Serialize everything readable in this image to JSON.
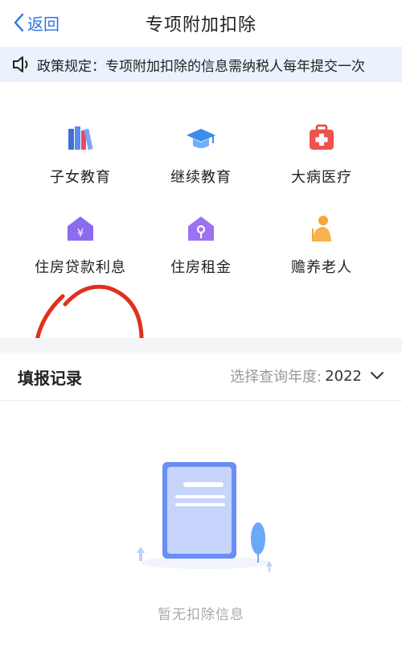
{
  "nav": {
    "back_label": "返回",
    "title": "专项附加扣除"
  },
  "notice": {
    "text": "政策规定：专项附加扣除的信息需纳税人每年提交一次"
  },
  "categories": [
    {
      "label": "子女教育",
      "icon": "books-icon"
    },
    {
      "label": "继续教育",
      "icon": "graduation-cap-icon"
    },
    {
      "label": "大病医疗",
      "icon": "medical-kit-icon"
    },
    {
      "label": "住房贷款利息",
      "icon": "house-yuan-icon"
    },
    {
      "label": "住房租金",
      "icon": "house-key-icon"
    },
    {
      "label": "赡养老人",
      "icon": "elder-icon"
    }
  ],
  "records": {
    "title": "填报记录",
    "year_prompt": "选择查询年度:",
    "year": "2022",
    "empty_text": "暂无扣除信息"
  },
  "colors": {
    "accent": "#2f72e8",
    "notice_bg": "#eaf2fd",
    "annotation_red": "#e0301e"
  }
}
